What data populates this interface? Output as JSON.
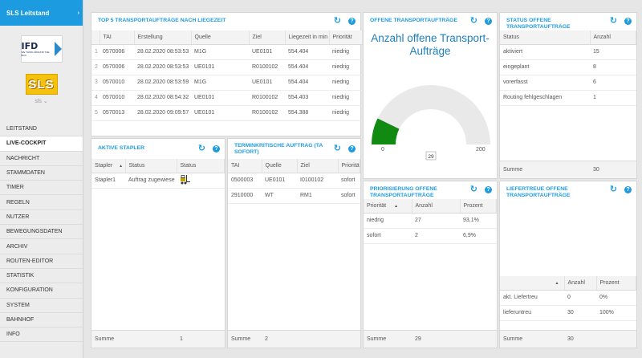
{
  "app": {
    "title": "SLS Leitstand",
    "logo_ifd": "IFD",
    "logo_ifd_sub": "WE THINK AROUND THE BOX",
    "logo_sls": "SLS",
    "user": "sls ⌄"
  },
  "nav": [
    {
      "label": "LEITSTAND"
    },
    {
      "label": "LIVE-COCKPIT",
      "active": true
    },
    {
      "label": "NACHRICHT"
    },
    {
      "label": "STAMMDATEN"
    },
    {
      "label": "TIMER"
    },
    {
      "label": "REGELN"
    },
    {
      "label": "NUTZER"
    },
    {
      "label": "BEWEGUNGSDATEN"
    },
    {
      "label": "ARCHIV"
    },
    {
      "label": "ROUTEN-EDITOR"
    },
    {
      "label": "STATISTIK"
    },
    {
      "label": "KONFIGURATION"
    },
    {
      "label": "SYSTEM"
    },
    {
      "label": "BAHNHOF"
    },
    {
      "label": "INFO"
    }
  ],
  "top5": {
    "title": "TOP 5 TRANSPORTAUFTRÄGE NACH LIEGEZEIT",
    "columns": [
      "",
      "TAI",
      "Erstellung",
      "Quelle",
      "Ziel",
      "Liegezeit in min",
      "Priorität"
    ],
    "rows": [
      [
        "1",
        "0570006",
        "28.02.2020 08:53:53",
        "M1G",
        "UE0101",
        "554.404",
        "niedrig"
      ],
      [
        "2",
        "0570006",
        "28.02.2020 08:53:53",
        "UE0101",
        "R0100102",
        "554.404",
        "niedrig"
      ],
      [
        "3",
        "0570010",
        "28.02.2020 08:53:59",
        "M1G",
        "UE0101",
        "554.404",
        "niedrig"
      ],
      [
        "4",
        "0570010",
        "28.02.2020 08:54:32",
        "UE0101",
        "R0100102",
        "554.403",
        "niedrig"
      ],
      [
        "5",
        "0570013",
        "28.02.2020 09:09:57",
        "UE0101",
        "R0100102",
        "554.388",
        "niedrig"
      ]
    ]
  },
  "offene": {
    "title": "OFFENE TRANSPORTAUFTRÄGE",
    "gauge_title": "Anzahl offene Transport-Aufträge",
    "value": 29,
    "min": 0,
    "max": 200,
    "color": "#118a11"
  },
  "status": {
    "title": "STATUS OFFENE TRANSPORTAUFTRÄGE",
    "columns": [
      "Status",
      "Anzahl"
    ],
    "rows": [
      [
        "aktiviert",
        "15"
      ],
      [
        "eingeplant",
        "8"
      ],
      [
        "vorerfasst",
        "6"
      ],
      [
        "Routing fehlgeschlagen",
        "1"
      ]
    ],
    "footer_label": "Summe",
    "footer_value": "30"
  },
  "stapler": {
    "title": "AKTIVE STAPLER",
    "columns": [
      "Stapler",
      "Status",
      "Status"
    ],
    "rows": [
      [
        "Stapler1",
        "Auftrag zugewiese",
        ""
      ]
    ],
    "footer_label": "Summe",
    "footer_value": "1"
  },
  "termin": {
    "title": "TERMINKRITISCHE AUFTRAG (TA SOFORT)",
    "columns": [
      "TAI",
      "Quelle",
      "Ziel",
      "Priorität"
    ],
    "rows": [
      [
        "0500003",
        "UE0101",
        "I0100102",
        "sofort"
      ],
      [
        "2910000",
        "WT",
        "RM1",
        "sofort"
      ]
    ],
    "footer_label": "Summe",
    "footer_value": "2"
  },
  "prio": {
    "title": "PRIORISIERUNG OFFENE TRANSPORTAUFTRÄGE",
    "columns": [
      "Priorität",
      "Anzahl",
      "Prozent"
    ],
    "rows": [
      [
        "niedrig",
        "27",
        "93,1%"
      ],
      [
        "sofort",
        "2",
        "6,9%"
      ]
    ],
    "footer_label": "Summe",
    "footer_value": "29"
  },
  "liefer": {
    "title": "LIEFERTREUE OFFENE TRANSPORTAUFTRÄGE",
    "columns": [
      "",
      "Anzahl",
      "Prozent"
    ],
    "rows": [
      [
        "akt. Liefertreu",
        "0",
        "0%"
      ],
      [
        "lieferuntreu",
        "30",
        "100%"
      ]
    ],
    "footer_label": "Summe",
    "footer_value": "30"
  },
  "icons": {
    "refresh": "refresh-icon",
    "help": "help-icon",
    "sort_up": "sort-asc-icon",
    "forklift": "forklift-icon"
  },
  "colors": {
    "accent": "#1d9be0",
    "gauge_fill": "#118a11"
  }
}
